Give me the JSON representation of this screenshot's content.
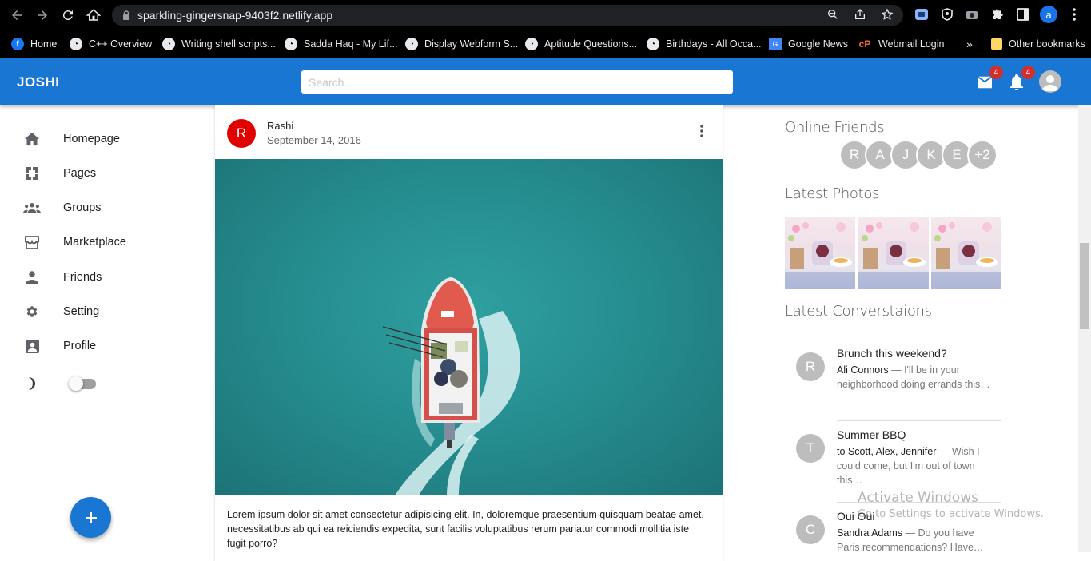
{
  "browser": {
    "url": "sparkling-gingersnap-9403f2.netlify.app",
    "profile_initial": "a",
    "bookmarks": [
      "Home",
      "C++ Overview",
      "Writing shell scripts...",
      "Sadda Haq - My Lif...",
      "Display Webform S...",
      "Aptitude Questions...",
      "Birthdays - All Occa...",
      "Google News",
      "Webmail Login"
    ],
    "overflow": "»",
    "other_bookmarks": "Other bookmarks"
  },
  "appbar": {
    "logo": "JOSHI",
    "search_placeholder": "Search...",
    "mail_badge": "4",
    "notif_badge": "4",
    "accent": "#1976d2"
  },
  "sidebar": {
    "items": [
      {
        "label": "Homepage",
        "icon": "home-icon"
      },
      {
        "label": "Pages",
        "icon": "pages-icon"
      },
      {
        "label": "Groups",
        "icon": "groups-icon"
      },
      {
        "label": "Marketplace",
        "icon": "storefront-icon"
      },
      {
        "label": "Friends",
        "icon": "person-icon"
      },
      {
        "label": "Setting",
        "icon": "settings-icon"
      },
      {
        "label": "Profile",
        "icon": "account-box-icon"
      }
    ],
    "dark_mode_on": false
  },
  "post": {
    "avatar": "R",
    "author": "Rashi",
    "date": "September 14, 2016",
    "text": "Lorem ipsum dolor sit amet consectetur adipisicing elit. In, doloremque praesentium quisquam beatae amet, necessitatibus ab qui ea reiciendis expedita, sunt facilis voluptatibus rerum pariatur commodi mollitia iste fugit porro?"
  },
  "rightbar": {
    "online_title": "Online Friends",
    "online_friends": [
      "R",
      "A",
      "J",
      "K",
      "E",
      "+2"
    ],
    "photos_title": "Latest Photos",
    "conversations_title": "Latest Converstaions",
    "conversations": [
      {
        "avatar": "R",
        "title": "Brunch this weekend?",
        "who": "Ali Connors",
        "text": " — I'll be in your neighborhood doing errands this…"
      },
      {
        "avatar": "T",
        "title": "Summer BBQ",
        "who": "to Scott, Alex, Jennifer",
        "text": " — Wish I could come, but I'm out of town this…"
      },
      {
        "avatar": "C",
        "title": "Oui Oui",
        "who": "Sandra Adams",
        "text": " — Do you have Paris recommendations? Have…"
      }
    ]
  },
  "watermark": {
    "line1": "Activate Windows",
    "line2": "Go to Settings to activate Windows."
  }
}
